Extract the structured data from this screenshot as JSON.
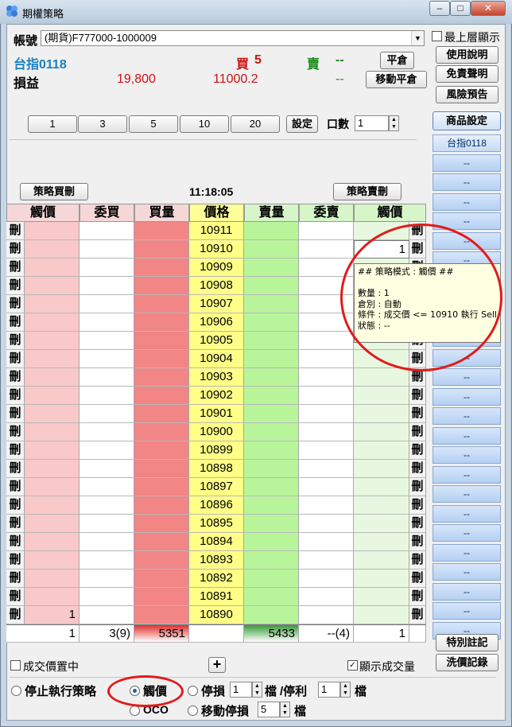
{
  "window": {
    "title": "期權策略",
    "buttons": {
      "minimize": "‒",
      "maximize": "□",
      "close": "✕"
    }
  },
  "account": {
    "label": "帳號",
    "value": "(期貨)F777000-1000009",
    "top_layer_label": "最上層顯示"
  },
  "info": {
    "product": "台指0118",
    "buy_label": "買",
    "buy_qty": "5",
    "sell_label": "賣",
    "sell_qty": "--",
    "pnl_label": "損益",
    "pnl_value": "19,800",
    "avg_price": "11000.2",
    "pnl_right": "--",
    "close_btn": "平倉",
    "move_close_btn": "移動平倉"
  },
  "side_buttons": {
    "manual": "使用說明",
    "disclaimer": "免責聲明",
    "risk": "風險預告",
    "product_settings": "商品設定",
    "notes": "特別註記",
    "wash": "洗價記錄"
  },
  "product_list": [
    "台指0118",
    "--",
    "--",
    "--",
    "--",
    "--",
    "--",
    "--",
    "--",
    "--",
    "--",
    "--",
    "--",
    "--",
    "--",
    "--",
    "--",
    "--",
    "--",
    "--",
    "--",
    "--",
    "--",
    "--",
    "--",
    "--"
  ],
  "qty_buttons": [
    "1",
    "3",
    "5",
    "10",
    "20"
  ],
  "set_btn": "設定",
  "qty_label": "口數",
  "qty_value": "1",
  "strategy_buy_btn": "策略買刪",
  "strategy_sell_btn": "策略賣刪",
  "clock": "11:18:05",
  "grid": {
    "headers": [
      "觸價",
      "委買",
      "買量",
      "價格",
      "賣量",
      "委賣",
      "觸價"
    ],
    "delete_label": "刪",
    "prices": [
      "10911",
      "10910",
      "10909",
      "10908",
      "10907",
      "10906",
      "10905",
      "10904",
      "10903",
      "10902",
      "10901",
      "10900",
      "10899",
      "10898",
      "10897",
      "10896",
      "10895",
      "10894",
      "10893",
      "10892",
      "10891",
      "10890"
    ],
    "left_trigger_last": "1",
    "right_trigger_10910": "1",
    "footer": {
      "left_trigger": "1",
      "bid_orders": "3(9)",
      "bid_vol": "5351",
      "price": "",
      "ask_vol": "5433",
      "ask_orders": "--(4)",
      "right_trigger": "1"
    }
  },
  "tooltip": {
    "title": "## 策略模式 : 觸價 ##",
    "qty": "數量 : 1",
    "pos": "倉別 : 自動",
    "cond": "條件 : 成交價 <= 10910 執行 Sell",
    "status": "狀態 : --"
  },
  "bottom": {
    "center_trade": "成交價置中",
    "plus": "+",
    "show_volume": "顯示成交量",
    "stop_strategy": "停止執行策略",
    "touch_price": "觸價",
    "oco": "OCO",
    "stop_loss": "停損",
    "stop_loss_val": "1",
    "tick1": "檔",
    "slash_take": "/停利",
    "take_profit_val": "1",
    "tick2": "檔",
    "trailing": "移動停損",
    "trailing_val": "5",
    "tick3": "檔"
  },
  "colors": {
    "trigger_bg": "#f9c8c8",
    "bid_vol_bg": "#f28585",
    "price_bg": "#ffff88",
    "ask_vol_bg": "#b8f59a",
    "right_trigger_bg": "#e8f7e0",
    "annotation": "#e21b1b"
  }
}
